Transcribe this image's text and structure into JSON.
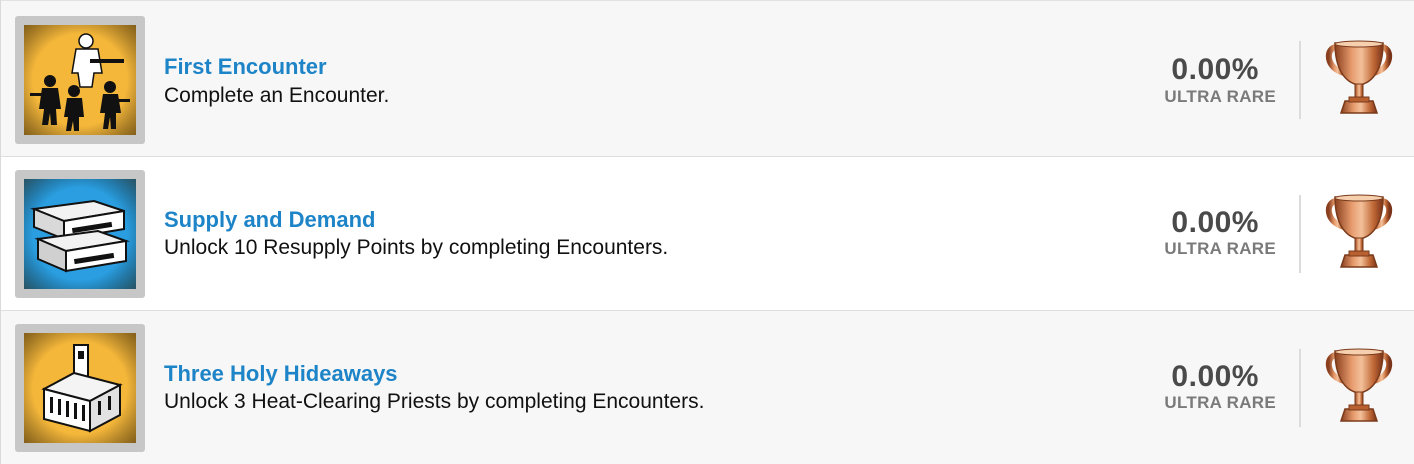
{
  "trophies": [
    {
      "title": "First Encounter",
      "description": "Complete an Encounter.",
      "percent": "0.00%",
      "rarity": "ULTRA RARE",
      "icon": "soldiers-art-icon",
      "icon_bg": "#f5b73a",
      "trophy_type": "bronze-trophy-icon"
    },
    {
      "title": "Supply and Demand",
      "description": "Unlock 10 Resupply Points by completing Encounters.",
      "percent": "0.00%",
      "rarity": "ULTRA RARE",
      "icon": "supply-crates-art-icon",
      "icon_bg": "#2a9ee0",
      "trophy_type": "bronze-trophy-icon"
    },
    {
      "title": "Three Holy Hideaways",
      "description": "Unlock 3 Heat-Clearing Priests by completing Encounters.",
      "percent": "0.00%",
      "rarity": "ULTRA RARE",
      "icon": "church-art-icon",
      "icon_bg": "#f5b73a",
      "trophy_type": "bronze-trophy-icon"
    }
  ],
  "colors": {
    "title": "#1e84c8",
    "trophy_bronze": "#c8723f"
  }
}
